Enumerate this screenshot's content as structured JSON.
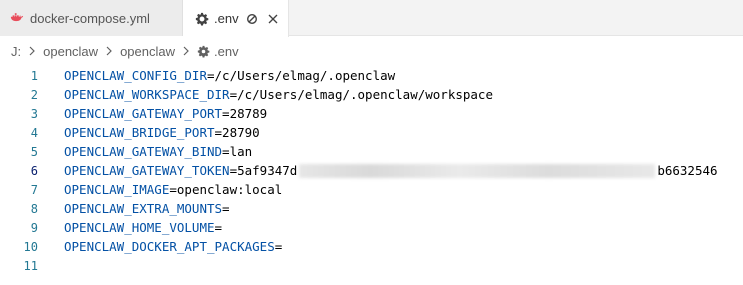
{
  "tabs": [
    {
      "label": "docker-compose.yml",
      "icon": "docker-whale-icon",
      "active": false
    },
    {
      "label": ".env",
      "icon": "gear-icon",
      "active": true
    }
  ],
  "breadcrumb": {
    "items": [
      "J:",
      "openclaw",
      "openclaw",
      ".env"
    ]
  },
  "editor": {
    "lines": [
      {
        "num": "1",
        "key": "OPENCLAW_CONFIG_DIR",
        "eq": "=",
        "value": "/c/Users/elmag/.openclaw"
      },
      {
        "num": "2",
        "key": "OPENCLAW_WORKSPACE_DIR",
        "eq": "=",
        "value": "/c/Users/elmag/.openclaw/workspace"
      },
      {
        "num": "3",
        "key": "OPENCLAW_GATEWAY_PORT",
        "eq": "=",
        "value": "28789"
      },
      {
        "num": "4",
        "key": "OPENCLAW_BRIDGE_PORT",
        "eq": "=",
        "value": "28790"
      },
      {
        "num": "5",
        "key": "OPENCLAW_GATEWAY_BIND",
        "eq": "=",
        "value": "lan"
      },
      {
        "num": "6",
        "key": "OPENCLAW_GATEWAY_TOKEN",
        "eq": "=",
        "value_start": "5af9347d",
        "value_end": "b6632546"
      },
      {
        "num": "7",
        "key": "OPENCLAW_IMAGE",
        "eq": "=",
        "value": "openclaw:local"
      },
      {
        "num": "8",
        "key": "OPENCLAW_EXTRA_MOUNTS",
        "eq": "=",
        "value": ""
      },
      {
        "num": "9",
        "key": "OPENCLAW_HOME_VOLUME",
        "eq": "=",
        "value": ""
      },
      {
        "num": "10",
        "key": "OPENCLAW_DOCKER_APT_PACKAGES",
        "eq": "=",
        "value": ""
      },
      {
        "num": "11",
        "key": "",
        "eq": "",
        "value": ""
      }
    ],
    "active_line": "6"
  },
  "colors": {
    "key": "#0451a5",
    "line_number": "#237893",
    "active_line_number": "#0b216f",
    "docker_icon": "#e84d5b"
  }
}
